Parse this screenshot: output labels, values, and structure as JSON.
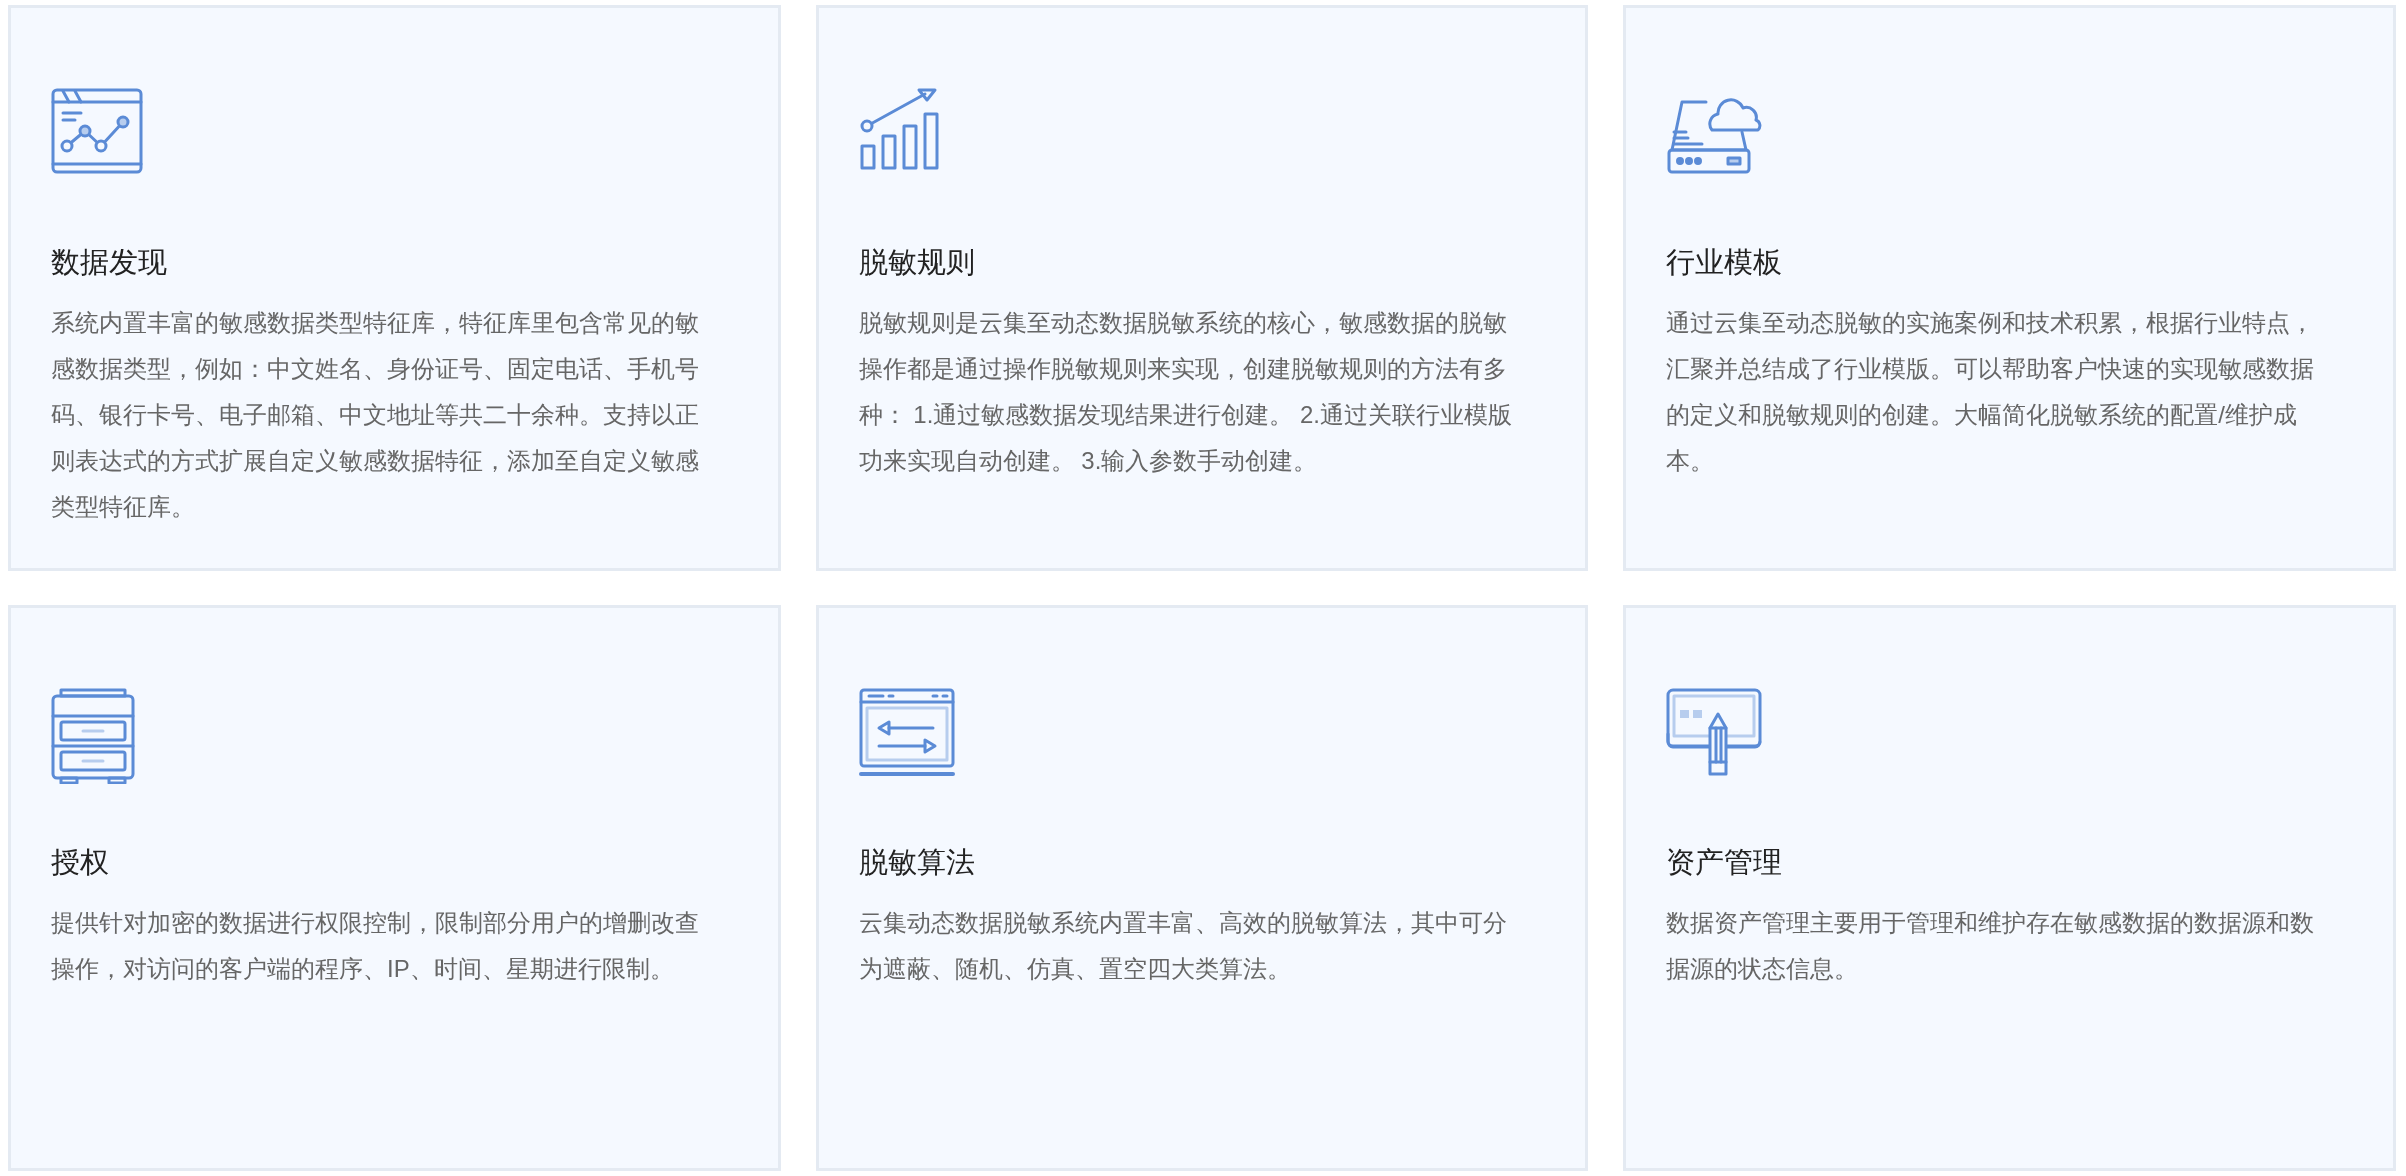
{
  "features": [
    {
      "title": "数据发现",
      "description": "系统内置丰富的敏感数据类型特征库，特征库里包含常见的敏感数据类型，例如：中文姓名、身份证号、固定电话、手机号码、银行卡号、电子邮箱、中文地址等共二十余种。支持以正则表达式的方式扩展自定义敏感数据特征，添加至自定义敏感类型特征库。"
    },
    {
      "title": "脱敏规则",
      "description": "脱敏规则是云集至动态数据脱敏系统的核心，敏感数据的脱敏操作都是通过操作脱敏规则来实现，创建脱敏规则的方法有多种： 1.通过敏感数据发现结果进行创建。 2.通过关联行业模版功来实现自动创建。 3.输入参数手动创建。"
    },
    {
      "title": "行业模板",
      "description": "通过云集至动态脱敏的实施案例和技术积累，根据行业特点，汇聚并总结成了行业模版。可以帮助客户快速的实现敏感数据的定义和脱敏规则的创建。大幅简化脱敏系统的配置/维护成本。"
    },
    {
      "title": "授权",
      "description": "提供针对加密的数据进行权限控制，限制部分用户的增删改查操作，对访问的客户端的程序、IP、时间、星期进行限制。"
    },
    {
      "title": "脱敏算法",
      "description": "云集动态数据脱敏系统内置丰富、高效的脱敏算法，其中可分为遮蔽、随机、仿真、置空四大类算法。"
    },
    {
      "title": "资产管理",
      "description": "数据资产管理主要用于管理和维护存在敏感数据的数据源和数据源的状态信息。"
    }
  ]
}
